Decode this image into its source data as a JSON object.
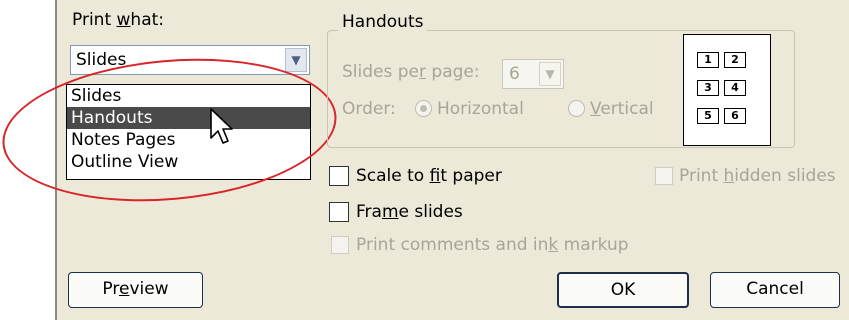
{
  "print_what": {
    "label_pre": "Print ",
    "label_accel": "w",
    "label_post": "hat:",
    "selected": "Slides",
    "options": [
      "Slides",
      "Handouts",
      "Notes Pages",
      "Outline View"
    ],
    "highlighted": "Handouts"
  },
  "handouts": {
    "title": "Handouts",
    "slides_per_page_pre": "Slides pe",
    "slides_per_page_accel": "r",
    "slides_per_page_post": " page:",
    "slides_per_page_value": "6",
    "order_label": "Order:",
    "horizontal_label": "Horizontal",
    "vertical_accel": "V",
    "vertical_post": "ertical",
    "preview_numbers": [
      "1",
      "2",
      "3",
      "4",
      "5",
      "6"
    ]
  },
  "options": {
    "scale_pre": "Scale to ",
    "scale_accel": "f",
    "scale_post": "it paper",
    "frame_pre": "Fra",
    "frame_accel": "m",
    "frame_post": "e slides",
    "comments_pre": "Print comments and in",
    "comments_accel": "k",
    "comments_post": " markup",
    "hidden_pre": "Print ",
    "hidden_accel": "h",
    "hidden_post": "idden slides"
  },
  "buttons": {
    "preview_pre": "Pr",
    "preview_accel": "e",
    "preview_post": "view",
    "ok": "OK",
    "cancel": "Cancel"
  },
  "colors": {
    "dialog_bg": "#ece9d8",
    "highlight_oval": "#d9242a",
    "selection_bg": "#4a4a4a"
  }
}
